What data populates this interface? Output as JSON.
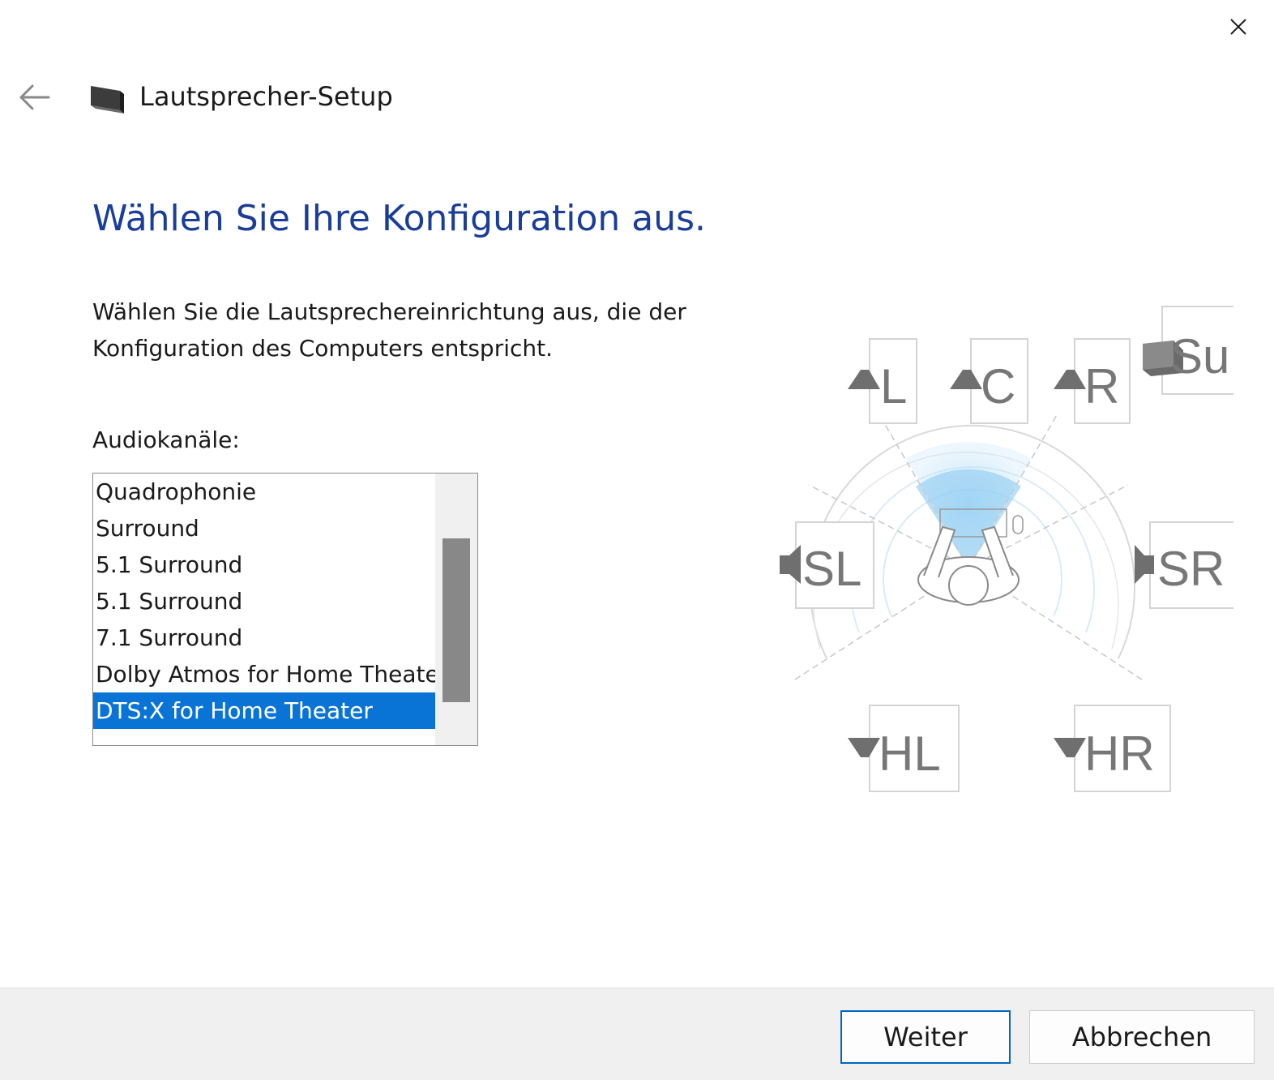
{
  "window": {
    "title": "Lautsprecher-Setup",
    "icons": {
      "back": "back-arrow-icon",
      "close": "close-icon",
      "app": "speaker-icon"
    }
  },
  "main": {
    "heading": "Wählen Sie Ihre Konfiguration aus.",
    "description": "Wählen Sie die Lautsprechereinrichtung aus, die der Konfiguration des Computers entspricht.",
    "channels_label": "Audiokanäle:",
    "channels": [
      "Quadrophonie",
      "Surround",
      "5.1 Surround",
      "5.1 Surround",
      "7.1 Surround",
      "Dolby Atmos for Home Theater",
      "DTS:X for Home Theater"
    ],
    "selected_channel": "DTS:X for Home Theater"
  },
  "diagram": {
    "speakers": {
      "front_left": "L",
      "center": "C",
      "front_right": "R",
      "subwoofer": "Su",
      "side_left": "SL",
      "side_right": "SR",
      "height_left": "HL",
      "height_right": "HR"
    }
  },
  "footer": {
    "next_label": "Weiter",
    "cancel_label": "Abbrechen"
  },
  "colors": {
    "heading": "#1a3d9a",
    "selection": "#0a74d6",
    "primary_border": "#0067c0",
    "footer_bg": "#f0f0f0"
  }
}
